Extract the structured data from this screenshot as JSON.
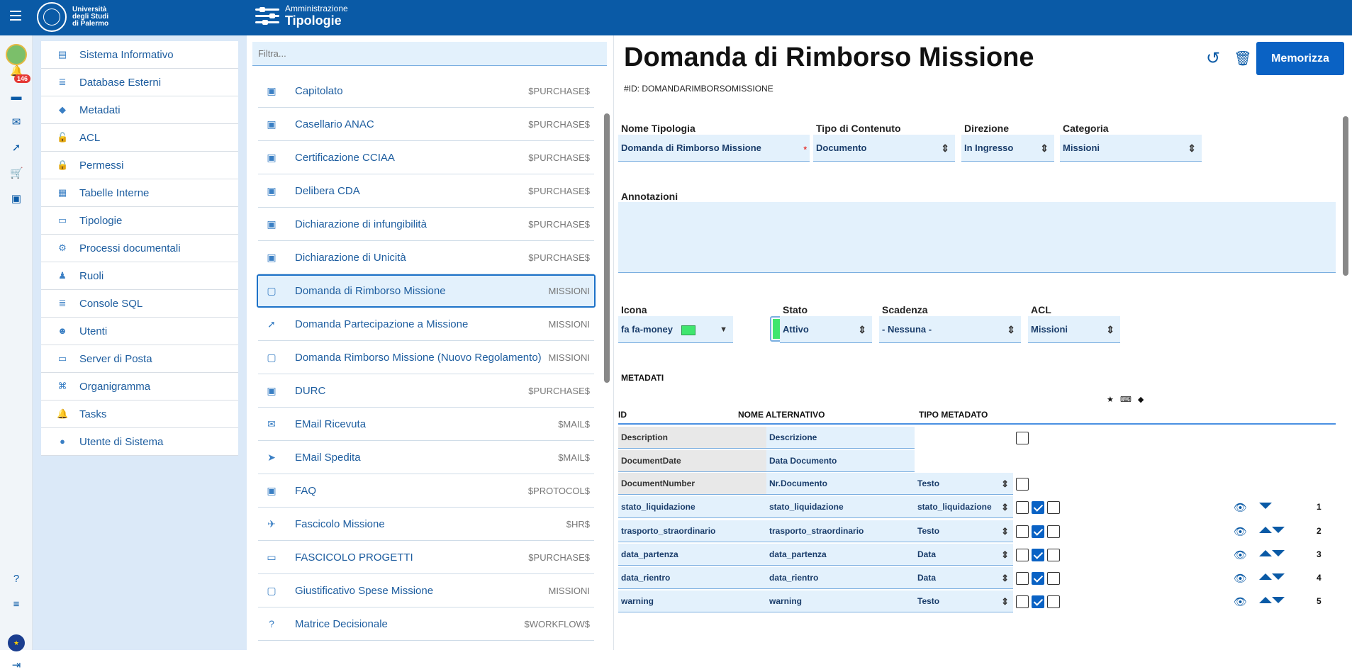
{
  "header": {
    "university": [
      "Università",
      "degli Studi",
      "di Palermo"
    ],
    "section": "Amministrazione",
    "title": "Tipologie"
  },
  "rail": {
    "notification_count": "146"
  },
  "menu": {
    "items": [
      {
        "label": "Sistema Informativo",
        "icon": "server-icon"
      },
      {
        "label": "Database Esterni",
        "icon": "database-icon"
      },
      {
        "label": "Metadati",
        "icon": "tags-icon"
      },
      {
        "label": "ACL",
        "icon": "unlock-icon"
      },
      {
        "label": "Permessi",
        "icon": "lock-icon"
      },
      {
        "label": "Tabelle Interne",
        "icon": "table-icon"
      },
      {
        "label": "Tipologie",
        "icon": "folder-icon"
      },
      {
        "label": "Processi documentali",
        "icon": "cogs-icon"
      },
      {
        "label": "Ruoli",
        "icon": "user-tie-icon"
      },
      {
        "label": "Console SQL",
        "icon": "database-icon"
      },
      {
        "label": "Utenti",
        "icon": "users-icon"
      },
      {
        "label": "Server di Posta",
        "icon": "inbox-icon"
      },
      {
        "label": "Organigramma",
        "icon": "sitemap-icon"
      },
      {
        "label": "Tasks",
        "icon": "bell-icon"
      },
      {
        "label": "Utente di Sistema",
        "icon": "user-icon"
      }
    ]
  },
  "list": {
    "filter_placeholder": "Filtra...",
    "items": [
      {
        "name": "Capitolato",
        "category": "$PURCHASE$",
        "icon": "image-icon"
      },
      {
        "name": "Casellario ANAC",
        "category": "$PURCHASE$",
        "icon": "image-icon"
      },
      {
        "name": "Certificazione CCIAA",
        "category": "$PURCHASE$",
        "icon": "image-icon"
      },
      {
        "name": "Delibera CDA",
        "category": "$PURCHASE$",
        "icon": "image-icon"
      },
      {
        "name": "Dichiarazione di infungibilità",
        "category": "$PURCHASE$",
        "icon": "image-icon"
      },
      {
        "name": "Dichiarazione di Unicità",
        "category": "$PURCHASE$",
        "icon": "image-icon"
      },
      {
        "name": "Domanda di Rimborso Missione",
        "category": "MISSIONI",
        "icon": "money-icon"
      },
      {
        "name": "Domanda Partecipazione a Missione",
        "category": "MISSIONI",
        "icon": "rocket-icon"
      },
      {
        "name": "Domanda Rimborso Missione (Nuovo Regolamento)",
        "category": "MISSIONI",
        "icon": "money-icon"
      },
      {
        "name": "DURC",
        "category": "$PURCHASE$",
        "icon": "image-icon"
      },
      {
        "name": "EMail Ricevuta",
        "category": "$MAIL$",
        "icon": "envelope-icon"
      },
      {
        "name": "EMail Spedita",
        "category": "$MAIL$",
        "icon": "paper-plane-icon"
      },
      {
        "name": "FAQ",
        "category": "$PROTOCOL$",
        "icon": "image-icon"
      },
      {
        "name": "Fascicolo Missione",
        "category": "$HR$",
        "icon": "plane-icon"
      },
      {
        "name": "FASCICOLO PROGETTI",
        "category": "$PURCHASE$",
        "icon": "folder-icon"
      },
      {
        "name": "Giustificativo Spese Missione",
        "category": "MISSIONI",
        "icon": "money-icon"
      },
      {
        "name": "Matrice Decisionale",
        "category": "$WORKFLOW$",
        "icon": "question-icon"
      }
    ]
  },
  "detail": {
    "title": "Domanda di Rimborso Missione",
    "id_text": "#ID: DOMANDARIMBORSOMISSIONE",
    "save_label": "Memorizza",
    "labels": {
      "nome": "Nome Tipologia",
      "tipo": "Tipo di Contenuto",
      "direzione": "Direzione",
      "categoria": "Categoria",
      "annotazioni": "Annotazioni",
      "icona": "Icona",
      "stato": "Stato",
      "scadenza": "Scadenza",
      "acl": "ACL"
    },
    "values": {
      "nome": "Domanda di Rimborso Missione",
      "tipo": "Documento",
      "direzione": "In Ingresso",
      "categoria": "Missioni",
      "icona": "fa fa-money",
      "stato": "Attivo",
      "scadenza": "- Nessuna -",
      "acl": "Missioni"
    },
    "color": "#40e66e",
    "metadati": {
      "heading": "METADATI",
      "col_id": "ID",
      "col_alt": "NOME ALTERNATIVO",
      "col_tipo": "TIPO METADATO",
      "rows": [
        {
          "id": "Description",
          "alt": "Descrizione",
          "tipo": "",
          "checks": [
            false
          ],
          "order": ""
        },
        {
          "id": "DocumentDate",
          "alt": "Data Documento",
          "tipo": "",
          "checks": [],
          "order": ""
        },
        {
          "id": "DocumentNumber",
          "alt": "Nr.Documento",
          "tipo": "Testo",
          "checks": [
            false
          ],
          "order": ""
        },
        {
          "id": "stato_liquidazione",
          "alt": "stato_liquidazione",
          "tipo": "stato_liquidazione",
          "checks": [
            false,
            true,
            false
          ],
          "order": "1"
        },
        {
          "id": "trasporto_straordinario",
          "alt": "trasporto_straordinario",
          "tipo": "Testo",
          "checks": [
            false,
            true,
            false
          ],
          "order": "2"
        },
        {
          "id": "data_partenza",
          "alt": "data_partenza",
          "tipo": "Data",
          "checks": [
            false,
            true,
            false
          ],
          "order": "3"
        },
        {
          "id": "data_rientro",
          "alt": "data_rientro",
          "tipo": "Data",
          "checks": [
            false,
            true,
            false
          ],
          "order": "4"
        },
        {
          "id": "warning",
          "alt": "warning",
          "tipo": "Testo",
          "checks": [
            false,
            true,
            false
          ],
          "order": "5"
        }
      ]
    }
  }
}
